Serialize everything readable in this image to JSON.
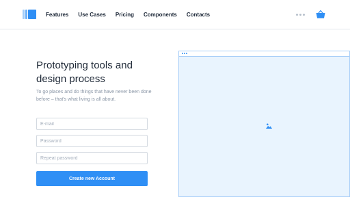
{
  "navbar": {
    "logo_icon": "logo-icon",
    "links": [
      {
        "label": "Features"
      },
      {
        "label": "Use Cases"
      },
      {
        "label": "Pricing"
      },
      {
        "label": "Components"
      },
      {
        "label": "Contacts"
      }
    ],
    "more_icon": "more-horizontal-icon",
    "cart_icon": "basket-icon"
  },
  "hero": {
    "title": "Prototyping tools and design process",
    "description": "To go places and do things that have never been done before – that's what living is all about."
  },
  "form": {
    "email_placeholder": "E-mail",
    "password_placeholder": "Password",
    "repeat_password_placeholder": "Repeat password",
    "submit_label": "Create new Account"
  },
  "preview": {
    "window_controls_icon": "window-dots-icon",
    "image_icon": "image-placeholder-icon"
  },
  "colors": {
    "accent": "#2f8ff5",
    "preview_bg": "#e9f4fe",
    "preview_border": "#a9cff8",
    "text": "#1f2937",
    "muted": "#8a96a6"
  }
}
